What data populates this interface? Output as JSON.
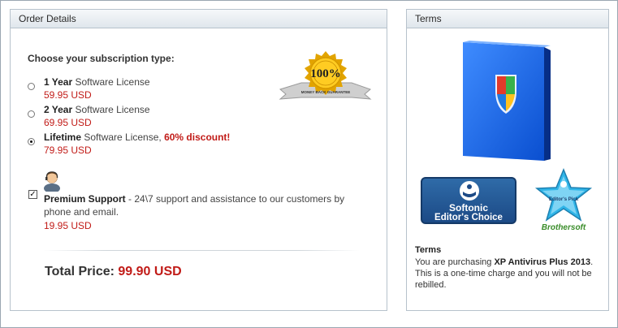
{
  "order": {
    "header": "Order Details",
    "choose_label": "Choose your subscription type:",
    "options": [
      {
        "bold": "1 Year",
        "rest": " Software License",
        "discount": "",
        "price": "59.95 USD",
        "selected": false
      },
      {
        "bold": "2 Year",
        "rest": " Software License",
        "discount": "",
        "price": "69.95 USD",
        "selected": false
      },
      {
        "bold": "Lifetime",
        "rest": " Software License, ",
        "discount": "60% discount!",
        "price": "79.95 USD",
        "selected": true
      }
    ],
    "seal": {
      "percent": "100%",
      "ribbon": "MONEY BACK GUARANTEE"
    },
    "support": {
      "checked": true,
      "title": "Premium Support",
      "text": " - 24\\7 support and assistance to our customers by phone and email.",
      "price": "19.95 USD"
    },
    "total_label": "Total Price:",
    "total_value": "99.90 USD"
  },
  "terms": {
    "header": "Terms",
    "softonic_line1": "Softonic",
    "softonic_line2": "Editor's Choice",
    "brothersoft_pick": "Editor's Pick",
    "brothersoft_name": "Brothersoft",
    "title": "Terms",
    "body_prefix": "You are purchasing ",
    "product": "XP Antivirus Plus 2013",
    "body_suffix": ". This is a one-time charge and you will not be rebilled."
  },
  "colors": {
    "price_red": "#c11b17",
    "header_bg": "#dfe6ec",
    "border": "#b7c2cc"
  }
}
